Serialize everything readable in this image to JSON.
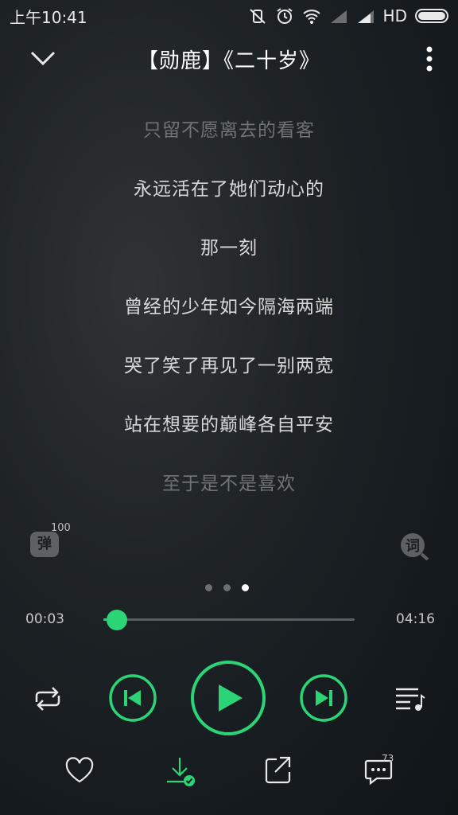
{
  "status_bar": {
    "time": "上午10:41",
    "network": "HD",
    "icons": [
      "mute-vibrate-icon",
      "alarm-icon",
      "wifi-icon",
      "signal-icon",
      "signal-icon",
      "battery-icon"
    ]
  },
  "header": {
    "title": "【勋鹿】《二十岁》",
    "back_icon": "chevron-down-icon",
    "more_icon": "more-vertical-icon"
  },
  "lyrics": [
    {
      "text": "只留不愿离去的看客",
      "dim": true
    },
    {
      "text": "永远活在了她们动心的",
      "dim": false
    },
    {
      "text": "那一刻",
      "dim": false
    },
    {
      "text": "曾经的少年如今隔海两端",
      "dim": false
    },
    {
      "text": "哭了笑了再见了一别两宽",
      "dim": false
    },
    {
      "text": "站在想要的巅峰各自平安",
      "dim": false
    },
    {
      "text": "至于是不是喜欢",
      "dim": true
    }
  ],
  "danmu": {
    "label": "弹",
    "count": "100"
  },
  "lyric_toggle": {
    "label": "词"
  },
  "pager": {
    "pages": 3,
    "active": 3
  },
  "progress": {
    "current": "00:03",
    "total": "04:16",
    "fraction": 0.012
  },
  "colors": {
    "accent": "#2bd576",
    "text": "#d8d8d8",
    "dim_text": "#6f7376"
  },
  "controls": {
    "loop_icon": "repeat-icon",
    "prev_icon": "skip-previous-icon",
    "play_icon": "play-icon",
    "next_icon": "skip-next-icon",
    "playlist_icon": "playlist-icon"
  },
  "bottom_actions": {
    "like_icon": "heart-icon",
    "download_icon": "download-icon",
    "share_icon": "share-icon",
    "comment_icon": "comment-icon",
    "comment_count": "73"
  }
}
